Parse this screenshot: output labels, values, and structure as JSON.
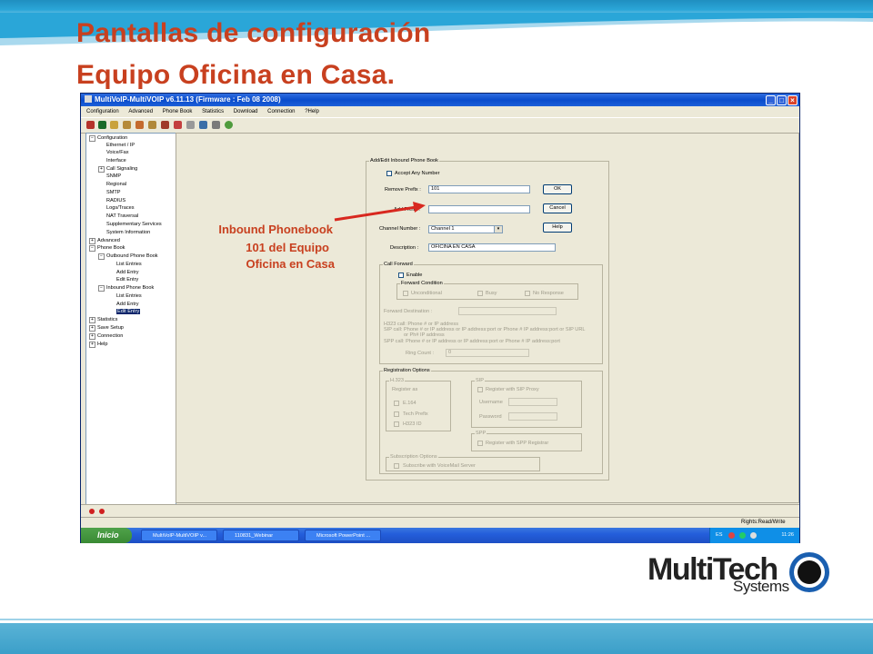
{
  "slide": {
    "title_line1": "Pantallas de configuración",
    "title_line2": "Equipo Oficina en Casa.",
    "annotation_line1": "Inbound Phonebook",
    "annotation_line2": "101 del Equipo",
    "annotation_line3": "Oficina en Casa",
    "accent_color": "#c8401f"
  },
  "logo": {
    "brand_a": "Multi",
    "brand_b": "Tech",
    "sub": "Systems"
  },
  "window": {
    "title": "MultiVoIP-MultiVOIP v6.11.13 (Firmware : Feb 08 2008)",
    "menu": [
      "Configuration",
      "Advanced",
      "Phone Book",
      "Statistics",
      "Download",
      "Connection",
      "?Help"
    ]
  },
  "tree": {
    "configuration": "Configuration",
    "ethernet": "Ethernet / IP",
    "voicefax": "Voice/Fax",
    "interface": "Interface",
    "callsignaling": "Call Signaling",
    "snmp": "SNMP",
    "regional": "Regional",
    "smtp": "SMTP",
    "radius": "RADIUS",
    "logs": "Logs/Traces",
    "nat": "NAT Traversal",
    "supp": "Supplementary Services",
    "sysinfo": "System Information",
    "advanced": "Advanced",
    "phonebook": "Phone Book",
    "outbound": "Outbound Phone Book",
    "ob_list": "List Entries",
    "ob_add": "Add Entry",
    "ob_edit": "Edit Entry",
    "inbound": "Inbound Phone Book",
    "ib_list": "List Entries",
    "ib_add": "Add Entry",
    "ib_edit": "Edit Entry",
    "statistics": "Statistics",
    "savesetup": "Save Setup",
    "connection": "Connection",
    "help": "Help"
  },
  "form": {
    "group_title": "Add/Edit Inbound Phone Book",
    "accept_any": "Accept Any Number",
    "remove_prefix_label": "Remove Prefix :",
    "remove_prefix_value": "101",
    "add_prefix_label": "Add Prefix :",
    "add_prefix_value": "",
    "channel_label": "Channel Number :",
    "channel_value": "Channel 1",
    "description_label": "Description :",
    "description_value": "OFICINA EN CASA",
    "ok": "OK",
    "cancel": "Cancel",
    "help": "Help",
    "call_forward": "Call Forward",
    "enable": "Enable",
    "forward_condition": "Forward Condition",
    "unconditional": "Unconditional",
    "busy": "Busy",
    "no_response": "No Response",
    "forward_destination": "Forward  Destination :",
    "hint1": "H323 call: Phone # or IP address",
    "hint2": "SIP call: Phone # or IP address or IP address:port or Phone # IP address:port or SIP URL",
    "hint3": "or Ph# IP address",
    "hint4": "SPP call: Phone # or IP address or IP address:port or Phone # IP address:port",
    "ring_count_label": "Ring Count :",
    "ring_count_value": "0",
    "registration_options": "Registration Options",
    "h323": "H.323",
    "register_as": "Register as",
    "e164": "E.164",
    "tech_prefix": "Tech Prefix",
    "h323_id": "H323 ID",
    "sip": "SIP",
    "register_sip_proxy": "Register with SIP Proxy",
    "username": "Username",
    "password": "Password",
    "spp": "SPP",
    "register_spp": "Register with SPP Registrar",
    "subscription_options": "Subscription Options",
    "subscribe_voicemail": "Subscribe with VoiceMail Server"
  },
  "status": {
    "rights": "Rights:Read/Write"
  },
  "taskbar": {
    "start": "Inicio",
    "task1": "MultiVoIP-MultiVOIP v...",
    "task2": "110831_Webinar",
    "task3": "Microsoft PowerPoint ...",
    "lang": "ES",
    "time": "11:26"
  }
}
